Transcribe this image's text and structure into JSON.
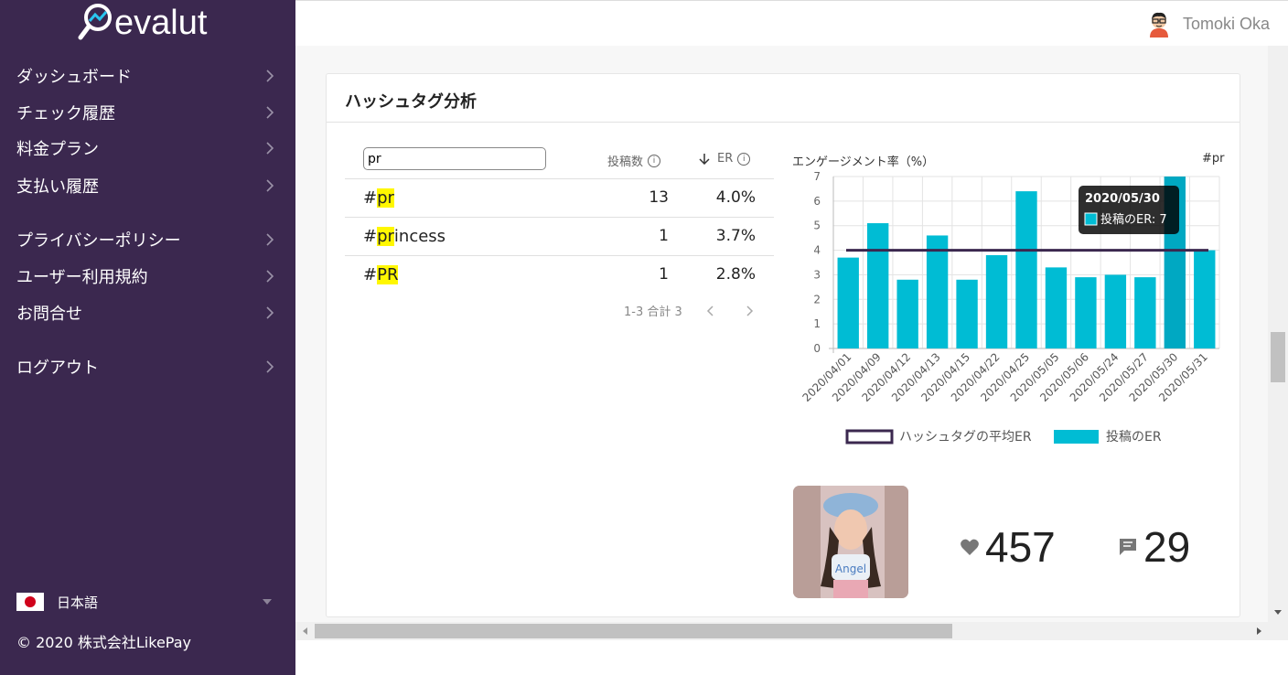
{
  "app": {
    "name": "evalut",
    "accent": "#3b284f",
    "bar_color": "#00bcd4",
    "avg_line_color": "#3b284f",
    "highlight": "#fff700"
  },
  "sidebar": {
    "items": [
      {
        "label": "ダッシュボード"
      },
      {
        "label": "チェック履歴"
      },
      {
        "label": "料金プラン"
      },
      {
        "label": "支払い履歴"
      },
      {
        "label": "プライバシーポリシー"
      },
      {
        "label": "ユーザー利用規約"
      },
      {
        "label": "お問合せ"
      },
      {
        "label": "ログアウト"
      }
    ],
    "language": "日本語",
    "copyright": "© 2020 株式会社LikePay"
  },
  "user": {
    "name": "Tomoki Oka"
  },
  "card": {
    "title": "ハッシュタグ分析"
  },
  "table": {
    "search_value": "pr",
    "col_posts": "投稿数",
    "col_er": "ER",
    "sort_icon": "arrow-down-icon",
    "rows": [
      {
        "prefix": "#",
        "match": "pr",
        "rest": "",
        "count": "13",
        "er": "4.0%"
      },
      {
        "prefix": "#",
        "match": "pr",
        "rest": "incess",
        "count": "1",
        "er": "3.7%"
      },
      {
        "prefix": "#",
        "match": "PR",
        "rest": "",
        "count": "1",
        "er": "2.8%"
      }
    ],
    "pager": "1-3 合計 3"
  },
  "chart_title": "エンゲージメント率（%）",
  "chart_tag": "#pr",
  "chart_data": {
    "type": "bar",
    "categories": [
      "2020/04/01",
      "2020/04/09",
      "2020/04/12",
      "2020/04/13",
      "2020/04/15",
      "2020/04/22",
      "2020/04/25",
      "2020/05/05",
      "2020/05/06",
      "2020/05/24",
      "2020/05/27",
      "2020/05/30",
      "2020/05/31"
    ],
    "series": [
      {
        "name": "投稿のER",
        "values": [
          3.7,
          5.1,
          2.8,
          4.6,
          2.8,
          3.8,
          6.4,
          3.3,
          2.9,
          3.0,
          2.9,
          7.0,
          4.0
        ]
      }
    ],
    "reference_line": {
      "name": "ハッシュタグの平均ER",
      "value": 4.0
    },
    "ylim": [
      0,
      7
    ],
    "yticks": [
      0,
      1,
      2,
      3,
      4,
      5,
      6,
      7
    ],
    "grid": true,
    "legend": "bottom",
    "tooltip": {
      "title": "2020/05/30",
      "label": "投稿のER: 7"
    }
  },
  "post": {
    "likes": "457",
    "comments": "29"
  }
}
